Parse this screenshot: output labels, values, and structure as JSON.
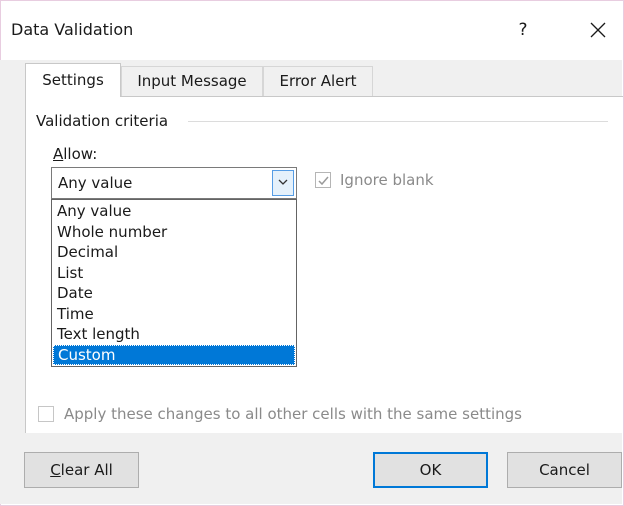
{
  "dialog": {
    "title": "Data Validation",
    "help_label": "?",
    "close_icon": "close-icon"
  },
  "tabs": [
    {
      "label": "Settings",
      "active": true
    },
    {
      "label": "Input Message",
      "active": false
    },
    {
      "label": "Error Alert",
      "active": false
    }
  ],
  "settings": {
    "group_label": "Validation criteria",
    "allow_label_accel": "A",
    "allow_label_rest": "llow:",
    "allow_value": "Any value",
    "ignore_blank_label": "Ignore blank",
    "ignore_blank_checked": true,
    "ignore_blank_disabled": true,
    "options": [
      "Any value",
      "Whole number",
      "Decimal",
      "List",
      "Date",
      "Time",
      "Text length",
      "Custom"
    ],
    "highlighted_option": "Custom",
    "apply_label": "Apply these changes to all other cells with the same settings",
    "apply_checked": false
  },
  "buttons": {
    "clear_accel": "C",
    "clear_rest": "lear All",
    "ok": "OK",
    "cancel": "Cancel"
  },
  "colors": {
    "selection": "#0078d7",
    "disabled_text": "#8a8a8a"
  }
}
